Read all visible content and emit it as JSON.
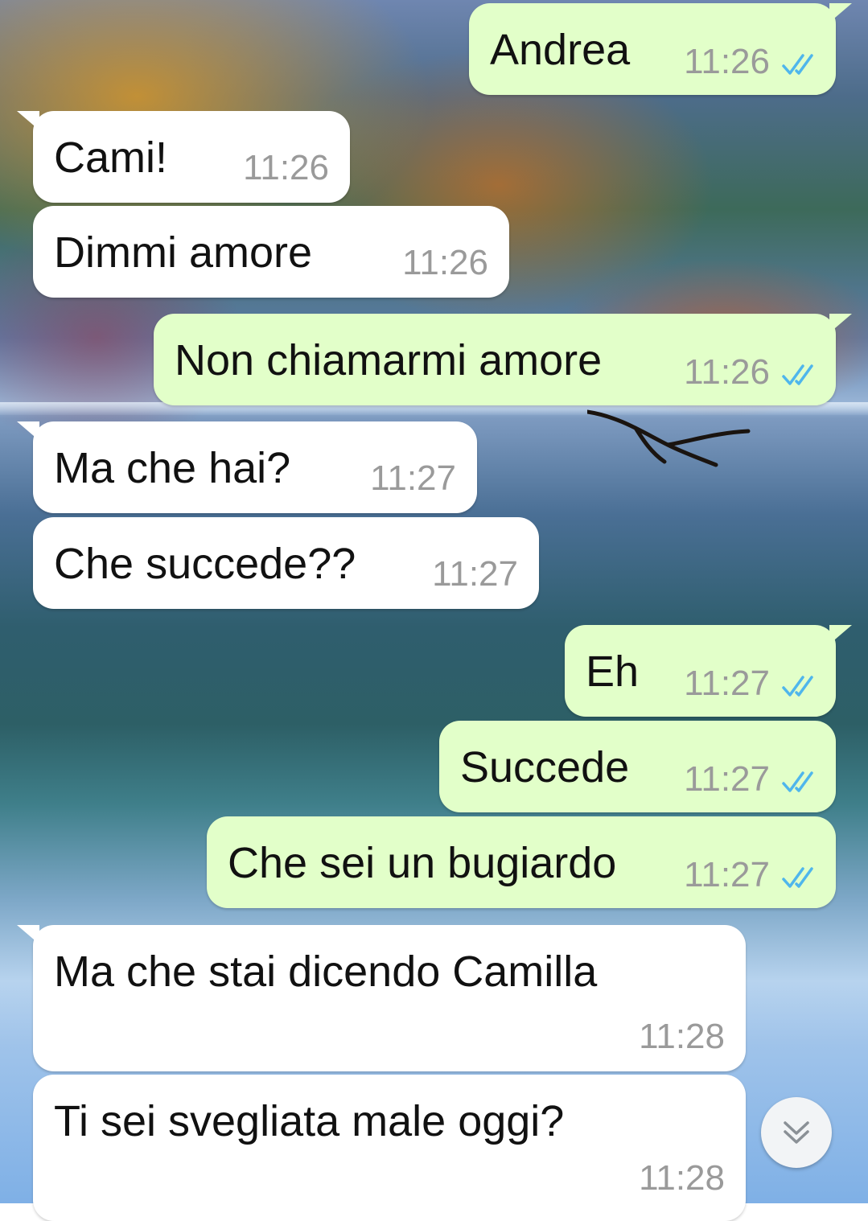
{
  "theme": {
    "incoming_bubble": "#ffffff",
    "outgoing_bubble": "#e2ffc9",
    "time_color": "#9a9a9a",
    "read_ticks_color": "#4fb6ec"
  },
  "messages": [
    {
      "direction": "out",
      "text": "Andrea",
      "time": "11:26",
      "status": "read-double-check-icon"
    },
    {
      "direction": "in",
      "text": "Cami!",
      "time": "11:26"
    },
    {
      "direction": "in",
      "text": "Dimmi amore",
      "time": "11:26"
    },
    {
      "direction": "out",
      "text": "Non chiamarmi amore",
      "time": "11:26",
      "status": "read-double-check-icon"
    },
    {
      "direction": "in",
      "text": "Ma che hai?",
      "time": "11:27"
    },
    {
      "direction": "in",
      "text": "Che succede??",
      "time": "11:27"
    },
    {
      "direction": "out",
      "text": "Eh",
      "time": "11:27",
      "status": "read-double-check-icon"
    },
    {
      "direction": "out",
      "text": "Succede",
      "time": "11:27",
      "status": "read-double-check-icon"
    },
    {
      "direction": "out",
      "text": "Che sei un bugiardo",
      "time": "11:27",
      "status": "read-double-check-icon"
    },
    {
      "direction": "in",
      "text": "Ma che stai dicendo Camilla",
      "time": "11:28"
    },
    {
      "direction": "in",
      "text": "Ti sei svegliata male oggi?",
      "time": "11:28"
    }
  ],
  "scroll_button": {
    "icon": "double-chevron-down-icon"
  }
}
